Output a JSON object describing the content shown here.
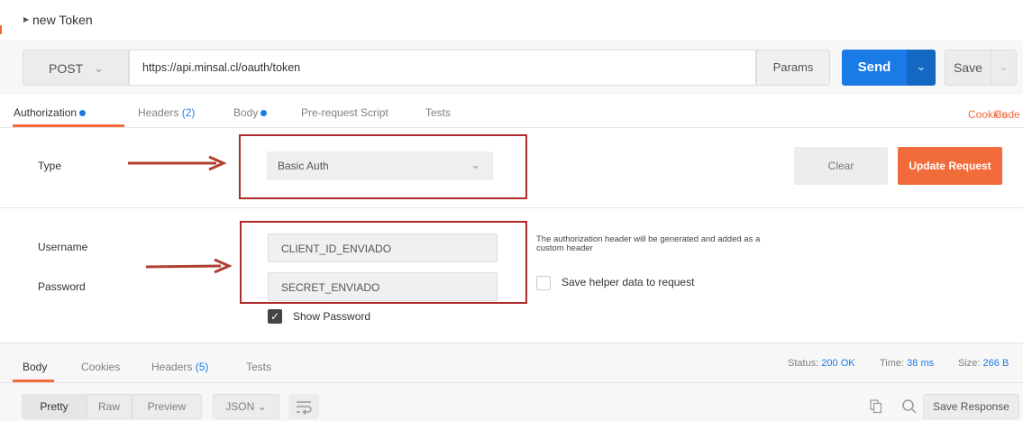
{
  "request": {
    "name": "new Token",
    "method": "POST",
    "url": "https://api.minsal.cl/oauth/token",
    "params_label": "Params",
    "send_label": "Send",
    "save_label": "Save"
  },
  "tabs": [
    {
      "label": "Authorization",
      "dot": true
    },
    {
      "label": "Headers",
      "count": "(2)"
    },
    {
      "label": "Body",
      "dot": true
    },
    {
      "label": "Pre-request Script"
    },
    {
      "label": "Tests"
    }
  ],
  "links": {
    "cookies": "Cookies",
    "code": "Code"
  },
  "auth": {
    "type_label": "Type",
    "type_value": "Basic Auth",
    "clear_label": "Clear",
    "update_label": "Update Request",
    "username_label": "Username",
    "username_value": "CLIENT_ID_ENVIADO",
    "password_label": "Password",
    "password_value": "SECRET_ENVIADO",
    "show_password_label": "Show Password",
    "show_password_checked": true,
    "note": "The authorization header will be generated and added as a custom header",
    "helper_label": "Save helper data to request",
    "helper_checked": false
  },
  "response": {
    "tabs": [
      {
        "label": "Body"
      },
      {
        "label": "Cookies"
      },
      {
        "label": "Headers",
        "count": "(5)"
      },
      {
        "label": "Tests"
      }
    ],
    "status_label": "Status:",
    "status_value": "200 OK",
    "time_label": "Time:",
    "time_value": "38 ms",
    "size_label": "Size:",
    "size_value": "266 B",
    "view_modes": [
      "Pretty",
      "Raw",
      "Preview"
    ],
    "format": "JSON",
    "save_response_label": "Save Response"
  },
  "colors": {
    "accent": "#f26b3a",
    "send": "#1a7be6",
    "annotation": "#b02a2a"
  }
}
